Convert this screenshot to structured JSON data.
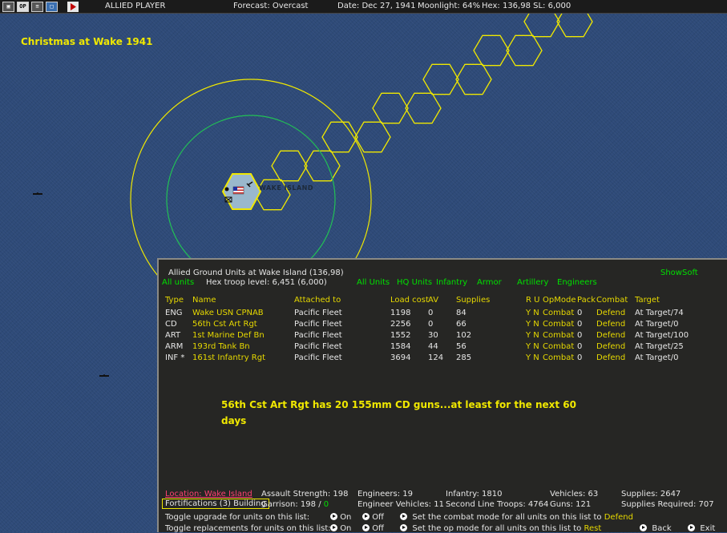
{
  "topbar": {
    "icons": [
      "map-view-icon",
      "op-icon",
      "list-icon",
      "window-icon",
      "end-turn-icon"
    ],
    "op_label": "OP",
    "player": "ALLIED PLAYER",
    "forecast": "Forecast: Overcast",
    "date": "Date: Dec 27, 1941",
    "moonlight": "Moonlight: 64%",
    "hex": "Hex: 136,98  SL: 6,000"
  },
  "map": {
    "title": "Christmas at Wake 1941",
    "base_label": "WAKE ISLAND",
    "colors": {
      "ocean": "#2e4a78",
      "hex_outline": "#f0e800",
      "range_outer": "#f0e800",
      "range_inner": "#22c055"
    }
  },
  "panel": {
    "title": "Allied Ground Units at Wake Island  (136,98)",
    "show_soft": "ShowSoft",
    "filter_all": "All units",
    "hex_troop_level": "Hex troop level: 6,451  (6,000)",
    "filters": [
      "All Units",
      "HQ Units",
      "Infantry",
      "Armor",
      "Artillery",
      "Engineers"
    ],
    "headers": {
      "type": "Type",
      "name": "Name",
      "attached": "Attached to",
      "load": "Load cost",
      "av": "AV",
      "supplies": "Supplies",
      "ru": "R U",
      "opmode": "OpMode",
      "pack": "Pack",
      "combat": "Combat",
      "target": "Target"
    },
    "units": [
      {
        "type": "ENG",
        "name": "Wake USN CPNAB",
        "attached": "Pacific Fleet",
        "load": "1198",
        "av": "0",
        "supplies": "84",
        "ru": "Y N",
        "opmode": "Combat",
        "pack": "0",
        "combat": "Defend",
        "target": "At Target/74"
      },
      {
        "type": "CD",
        "name": "56th Cst Art Rgt",
        "attached": "Pacific Fleet",
        "load": "2256",
        "av": "0",
        "supplies": "66",
        "ru": "Y N",
        "opmode": "Combat",
        "pack": "0",
        "combat": "Defend",
        "target": "At Target/0"
      },
      {
        "type": "ART",
        "name": "1st Marine Def Bn",
        "attached": "Pacific Fleet",
        "load": "1552",
        "av": "30",
        "supplies": "102",
        "ru": "Y N",
        "opmode": "Combat",
        "pack": "0",
        "combat": "Defend",
        "target": "At Target/100"
      },
      {
        "type": "ARM",
        "name": "193rd Tank Bn",
        "attached": "Pacific Fleet",
        "load": "1584",
        "av": "44",
        "supplies": "56",
        "ru": "Y N",
        "opmode": "Combat",
        "pack": "0",
        "combat": "Defend",
        "target": "At Target/25"
      },
      {
        "type": "INF *",
        "name": "161st Infantry Rgt",
        "attached": "Pacific Fleet",
        "load": "3694",
        "av": "124",
        "supplies": "285",
        "ru": "Y N",
        "opmode": "Combat",
        "pack": "0",
        "combat": "Defend",
        "target": "At Target/0"
      }
    ],
    "note": "56th Cst Art Rgt has 20 155mm CD guns...at least for the next 60 days",
    "footer": {
      "location": "Location: Wake Island",
      "fortifications": "Fortifications (3) Building",
      "assault_strength": "Assault Strength: 198",
      "garrison_label": "Garrison: 198",
      "garrison_sep": "/",
      "garrison_value": "0",
      "engineers": "Engineers: 19",
      "engineer_vehicles": "Engineer Vehicles: 11",
      "infantry": "Infantry: 1810",
      "second_line": "Second Line Troops: 4764",
      "vehicles": "Vehicles: 63",
      "guns": "Guns: 121",
      "supplies": "Supplies: 2647",
      "supplies_required": "Supplies Required: 707",
      "toggle_upgrade": "Toggle upgrade for units on this list:",
      "toggle_replacements": "Toggle replacements for units on this list:",
      "on": "On",
      "off": "Off",
      "set_combat": "Set the combat mode for all units on this list to",
      "combat_mode_value": "Defend",
      "set_op": "Set the op mode for all units on this list to",
      "op_mode_value": "Rest",
      "back": "Back",
      "exit": "Exit"
    }
  }
}
